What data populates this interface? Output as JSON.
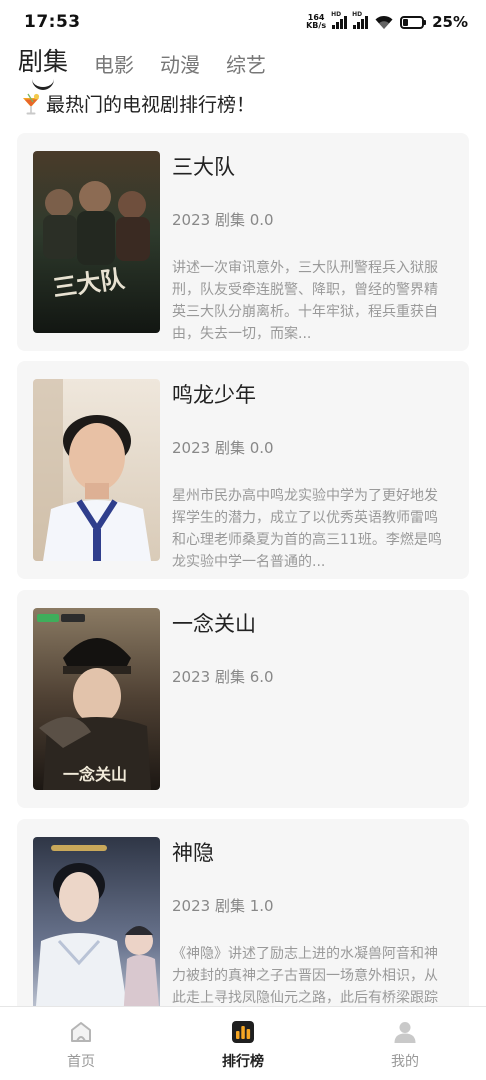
{
  "status_bar": {
    "time": "17:53",
    "net_speed_value": "164",
    "net_speed_unit": "KB/s",
    "signal_tag": "HD",
    "battery_percent": "25%",
    "battery_level": 0.25,
    "icons": [
      "signal-icon",
      "signal-icon",
      "wifi-icon",
      "battery-icon"
    ]
  },
  "tabs": [
    {
      "label": "剧集",
      "active": true
    },
    {
      "label": "电影",
      "active": false
    },
    {
      "label": "动漫",
      "active": false
    },
    {
      "label": "综艺",
      "active": false
    }
  ],
  "section": {
    "icon": "cocktail-icon",
    "title": "最热门的电视剧排行榜！"
  },
  "items": [
    {
      "title": "三大队",
      "meta": "2023 剧集 0.0",
      "description": "讲述一次审讯意外，三大队刑警程兵入狱服刑，队友受牵连脱警、降职，曾经的警界精英三大队分崩离析。十年牢狱，程兵重获自由，失去一切，而案...",
      "poster_text": "三大队",
      "poster_colors": [
        "#2e3a2c",
        "#59503a",
        "#1a1f1a"
      ]
    },
    {
      "title": "鸣龙少年",
      "meta": "2023 剧集 0.0",
      "description": "星州市民办高中鸣龙实验中学为了更好地发挥学生的潜力，成立了以优秀英语教师雷鸣和心理老师桑夏为首的高三11班。李燃是鸣龙实验中学一名普通的...",
      "poster_text": "",
      "poster_colors": [
        "#e9dfd1",
        "#c98f6a",
        "#2f3e8c"
      ]
    },
    {
      "title": "一念关山",
      "meta": "2023 剧集 6.0",
      "description": "",
      "poster_text": "一念关山",
      "poster_colors": [
        "#3a3128",
        "#6d5b46",
        "#1c1713"
      ]
    },
    {
      "title": "神隐",
      "meta": "2023 剧集 1.0",
      "description": "《神隐》讲述了励志上进的水凝兽阿音和神力被封的真神之子古晋因一场意外相识，从此走上寻找凤隐仙元之路，此后有桥梁跟踪凌峰，两族分立安宁这...",
      "poster_text": "",
      "poster_colors": [
        "#3d4557",
        "#d9cfc6",
        "#8a96ad"
      ]
    }
  ],
  "bottom_nav": [
    {
      "label": "首页",
      "icon": "home-icon",
      "active": false
    },
    {
      "label": "排行榜",
      "icon": "ranking-icon",
      "active": true
    },
    {
      "label": "我的",
      "icon": "profile-icon",
      "active": false
    }
  ],
  "colors": {
    "accent": "#f5a623",
    "card_bg": "#f6f6f6",
    "text_primary": "#222222",
    "text_secondary": "#888888"
  }
}
